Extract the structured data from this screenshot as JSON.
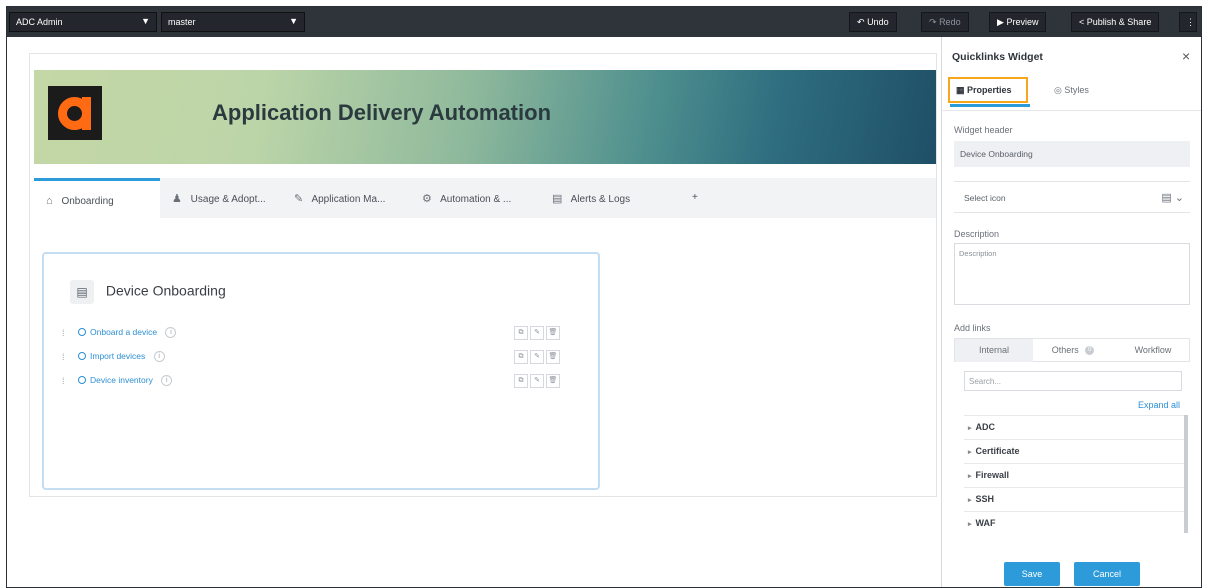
{
  "topbar": {
    "app_select": "ADC Admin",
    "branch_select": "master",
    "undo_label": "Undo",
    "redo_label": "Redo",
    "preview_label": "Preview",
    "publish_label": "Publish & Share",
    "more_label": "⋮"
  },
  "canvas": {
    "banner_title": "Application Delivery Automation",
    "tabs": [
      {
        "label": "Onboarding"
      },
      {
        "label": "Usage & Adopt..."
      },
      {
        "label": "Application Ma..."
      },
      {
        "label": "Automation & ..."
      },
      {
        "label": "Alerts & Logs"
      }
    ],
    "add_tab": "+"
  },
  "widget": {
    "title": "Device Onboarding",
    "links": [
      {
        "label": "Onboard a device"
      },
      {
        "label": "Import devices"
      },
      {
        "label": "Device inventory"
      }
    ]
  },
  "panel": {
    "title": "Quicklinks Widget",
    "close": "×",
    "tab_properties": "Properties",
    "tab_styles": "Styles",
    "widget_header_label": "Widget header",
    "widget_header_value": "Device Onboarding",
    "select_icon_label": "Select icon",
    "description_label": "Description",
    "description_placeholder": "Description",
    "add_links_label": "Add links",
    "link_tabs": [
      "Internal",
      "Others",
      "Workflow"
    ],
    "others_badge": "0",
    "search_placeholder": "Search...",
    "expand_all": "Expand all",
    "tree": [
      "ADC",
      "Certificate",
      "Firewall",
      "SSH",
      "WAF"
    ],
    "save_label": "Save",
    "cancel_label": "Cancel"
  },
  "colors": {
    "accent": "#2d9bd9",
    "highlight": "#f7a71b",
    "topbar": "#2f343b",
    "logo": "#ff6a13"
  }
}
